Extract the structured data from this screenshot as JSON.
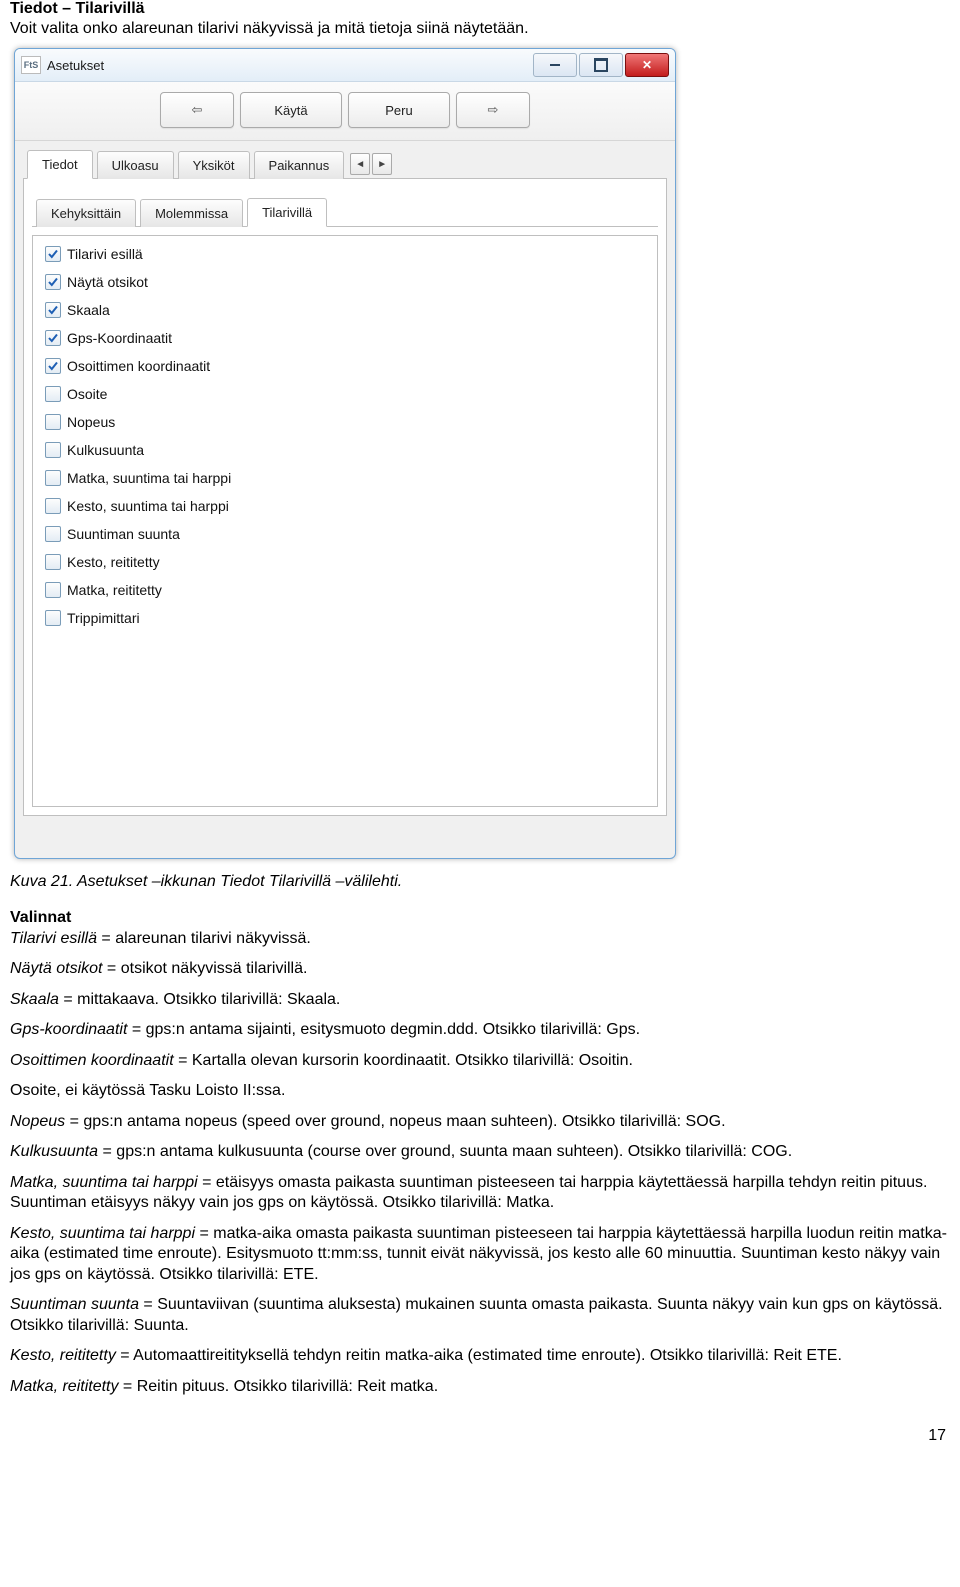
{
  "heading": "Tiedot – Tilarivillä",
  "subheading": "Voit valita onko alareunan tilarivi näkyvissä ja mitä tietoja siinä näytetään.",
  "window": {
    "appicon": "FtS",
    "title": "Asetukset",
    "toolbar": {
      "back_arrow": "⇦",
      "use": "Käytä",
      "cancel": "Peru",
      "fwd_arrow": "⇨"
    },
    "tabs_top": {
      "t1": "Tiedot",
      "t2": "Ulkoasu",
      "t3": "Yksiköt",
      "t4": "Paikannus",
      "arrow_left": "◄",
      "arrow_right": "►"
    },
    "tabs_inner": {
      "i1": "Kehyksittäin",
      "i2": "Molemmissa",
      "i3": "Tilarivillä"
    },
    "checks": [
      {
        "label": "Tilarivi esillä",
        "checked": true
      },
      {
        "label": "Näytä otsikot",
        "checked": true
      },
      {
        "label": "Skaala",
        "checked": true
      },
      {
        "label": "Gps-Koordinaatit",
        "checked": true
      },
      {
        "label": "Osoittimen koordinaatit",
        "checked": true
      },
      {
        "label": "Osoite",
        "checked": false
      },
      {
        "label": "Nopeus",
        "checked": false
      },
      {
        "label": "Kulkusuunta",
        "checked": false
      },
      {
        "label": "Matka, suuntima tai harppi",
        "checked": false
      },
      {
        "label": "Kesto, suuntima tai harppi",
        "checked": false
      },
      {
        "label": "Suuntiman suunta",
        "checked": false
      },
      {
        "label": "Kesto, reititetty",
        "checked": false
      },
      {
        "label": "Matka, reititetty",
        "checked": false
      },
      {
        "label": "Trippimittari",
        "checked": false
      }
    ]
  },
  "caption": "Kuva 21. Asetukset –ikkunan Tiedot Tilarivillä –välilehti.",
  "valinnat": "Valinnat",
  "para": {
    "p1a": "Tilarivi esillä",
    "p1b": " = alareunan tilarivi näkyvissä.",
    "p2a": "Näytä otsikot",
    "p2b": " = otsikot näkyvissä tilarivillä.",
    "p3a": "Skaala",
    "p3b": " = mittakaava. Otsikko tilarivillä: Skaala.",
    "p4a": "Gps-koordinaatit",
    "p4b": " = gps:n antama sijainti, esitysmuoto degmin.ddd. Otsikko tilarivillä: Gps.",
    "p5a": "Osoittimen koordinaatit",
    "p5b": " = Kartalla olevan kursorin koordinaatit. Otsikko tilarivillä: Osoitin.",
    "p6": "Osoite, ei käytössä Tasku Loisto II:ssa.",
    "p7a": "Nopeus",
    "p7b": " = gps:n antama nopeus (speed over ground, nopeus maan suhteen). Otsikko tilarivillä: SOG.",
    "p8a": "Kulkusuunta",
    "p8b": " = gps:n antama kulkusuunta (course over ground, suunta maan suhteen). Otsikko tilarivillä: COG.",
    "p9a": "Matka, suuntima tai harppi",
    "p9b": " = etäisyys omasta paikasta suuntiman pisteeseen tai harppia käytettäessä harpilla tehdyn reitin pituus. Suuntiman etäisyys näkyy vain jos gps on käytössä. Otsikko tilarivillä: Matka.",
    "p10a": "Kesto, suuntima tai harppi",
    "p10b": " = matka-aika omasta paikasta suuntiman pisteeseen tai harppia käytettäessä harpilla luodun reitin matka-aika (estimated time enroute). Esitysmuoto tt:mm:ss, tunnit eivät näkyvissä, jos kesto alle 60 minuuttia. Suuntiman kesto näkyy vain jos gps on käytössä. Otsikko tilarivillä: ETE.",
    "p11a": "Suuntiman suunta",
    "p11b": " = Suuntaviivan (suuntima aluksesta) mukainen suunta omasta paikasta. Suunta näkyy vain kun gps on käytössä. Otsikko tilarivillä: Suunta.",
    "p12a": "Kesto, reititetty",
    "p12b": " = Automaattireitityksellä tehdyn reitin matka-aika (estimated time enroute). Otsikko tilarivillä: Reit ETE.",
    "p13a": "Matka, reititetty",
    "p13b": " = Reitin pituus. Otsikko tilarivillä: Reit matka."
  },
  "pagenum": "17"
}
